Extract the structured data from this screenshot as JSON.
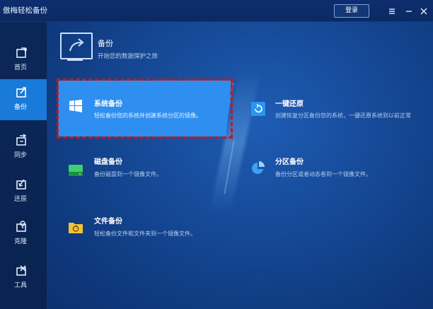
{
  "app": {
    "title": "傲梅轻松备份",
    "login_label": "登录",
    "menu_icon": "menu-icon",
    "minimize_icon": "minimize-icon",
    "close_icon": "close-icon"
  },
  "sidebar": {
    "items": [
      {
        "label": "首页",
        "icon": "home-icon"
      },
      {
        "label": "备份",
        "icon": "backup-icon",
        "active": true
      },
      {
        "label": "同步",
        "icon": "sync-icon"
      },
      {
        "label": "还原",
        "icon": "restore-icon"
      },
      {
        "label": "克隆",
        "icon": "clone-icon"
      },
      {
        "label": "工具",
        "icon": "tools-icon"
      }
    ]
  },
  "main": {
    "header": {
      "title": "备份",
      "subtitle": "开始您的数据保护之旅",
      "icon": "monitor-arrow-icon"
    },
    "cards": [
      {
        "title": "系统备份",
        "desc": "轻松备份您的系统并创建系统分区的镜像。",
        "icon": "windows-icon",
        "selected": true
      },
      {
        "title": "一键还原",
        "desc": "创建恢复分区备份您的系统，一键还原系统到以前正常",
        "icon": "one-key-restore-icon"
      },
      {
        "title": "磁盘备份",
        "desc": "备份磁盘到一个镜像文件。",
        "icon": "disk-icon"
      },
      {
        "title": "分区备份",
        "desc": "备份分区或者动态卷到一个镜像文件。",
        "icon": "partition-pie-icon"
      },
      {
        "title": "文件备份",
        "desc": "轻松备份文件和文件夹到一个镜像文件。",
        "icon": "file-folder-icon"
      }
    ]
  },
  "colors": {
    "accent": "#2f8ff0",
    "selection_outline": "#c21a1a",
    "sidebar_active": "#1a7ad9"
  }
}
